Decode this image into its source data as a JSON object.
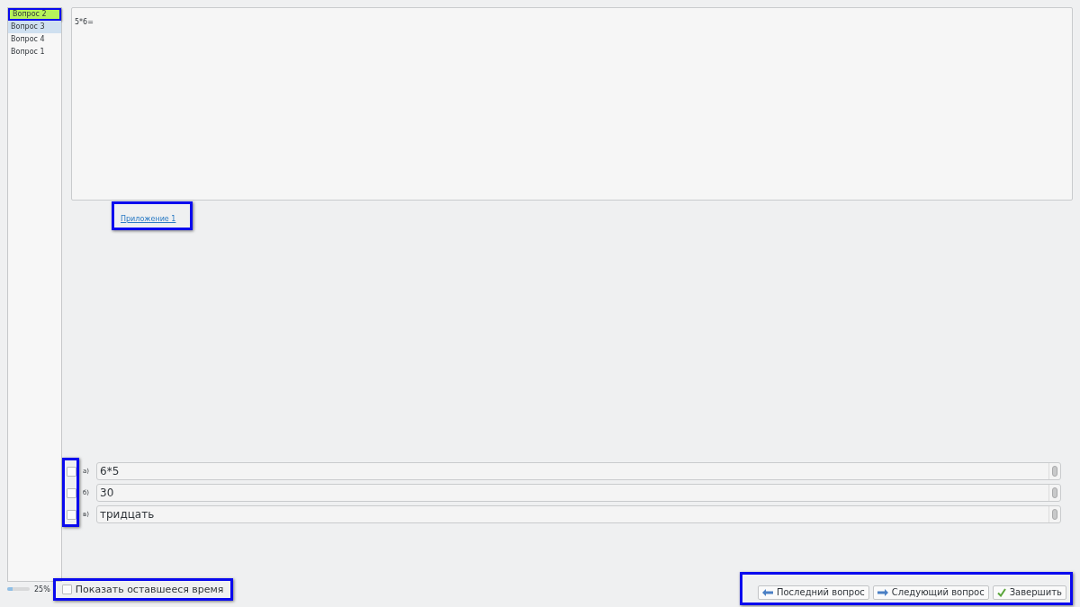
{
  "sidebar": {
    "items": [
      {
        "label": "Вопрос 2",
        "selected": true,
        "highlighted": true
      },
      {
        "label": "Вопрос 3",
        "selected": false,
        "highlighted": false
      },
      {
        "label": "Вопрос 4",
        "selected": false,
        "highlighted": false
      },
      {
        "label": "Вопрос 1",
        "selected": false,
        "highlighted": false
      }
    ]
  },
  "question": {
    "text": "5*6=",
    "attachment_link": "Приложение 1"
  },
  "answers": [
    {
      "letter": "а)",
      "value": "6*5",
      "checked": false
    },
    {
      "letter": "б)",
      "value": "30",
      "checked": false
    },
    {
      "letter": "в)",
      "value": "тридцать",
      "checked": false
    }
  ],
  "progress": {
    "level": 0.25,
    "reading": "25%"
  },
  "show_time": {
    "label": "Показать оставшееся время",
    "checked": false
  },
  "buttons": [
    {
      "kind": "back",
      "label": "Последний вопрос"
    },
    {
      "kind": "forward",
      "label": "Следующий вопрос"
    },
    {
      "kind": "finish",
      "label": "Завершить"
    }
  ]
}
